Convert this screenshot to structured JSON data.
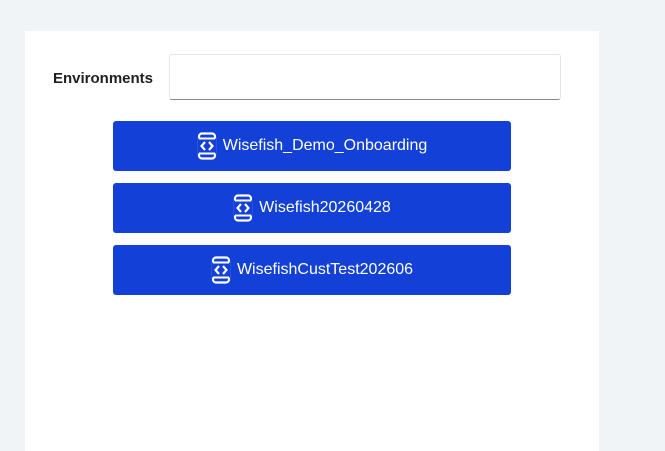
{
  "colors": {
    "page_background": "#f1f4f7",
    "card_background": "#ffffff",
    "button_accent": "#1340d6",
    "button_text": "#ffffff"
  },
  "environments": {
    "label": "Environments",
    "input_value": "",
    "items": [
      {
        "label": "Wisefish_Demo_Onboarding",
        "icon": "environment-code-icon"
      },
      {
        "label": "Wisefish20260428",
        "icon": "environment-code-icon"
      },
      {
        "label": "WisefishCustTest202606",
        "icon": "environment-code-icon"
      }
    ]
  }
}
